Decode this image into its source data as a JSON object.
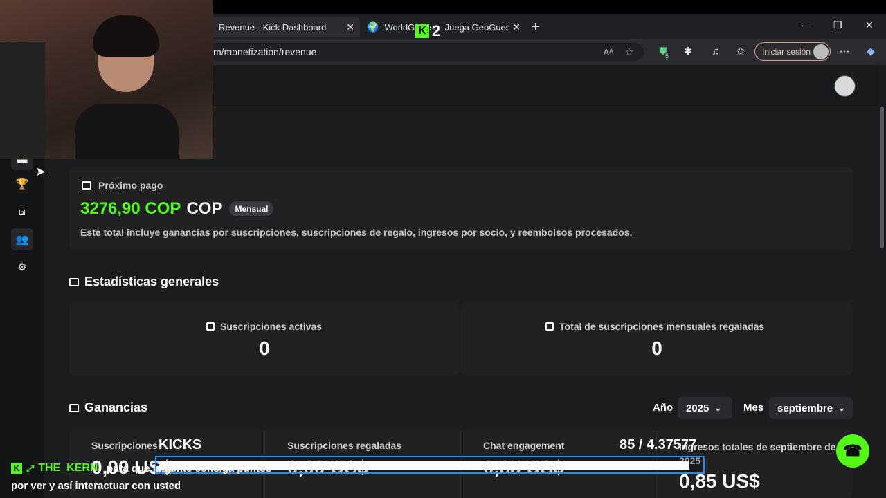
{
  "browser": {
    "tabs": [
      {
        "label": "Revenue - Kick Dashboard",
        "active": true
      },
      {
        "label": "WorldGuessr - Juega GeoGuessr g",
        "active": false
      }
    ],
    "new_tab_glyph": "+",
    "url": "m/monetization/revenue",
    "signin_label": "Iniciar sesión",
    "extension_badge": "5"
  },
  "sidebar": {
    "items": [
      {
        "icon": "dash-icon",
        "glyph": "▬"
      },
      {
        "icon": "trophy-icon",
        "glyph": "🏆"
      },
      {
        "icon": "stream-icon",
        "glyph": "⧈"
      },
      {
        "icon": "users-icon",
        "glyph": "👥"
      },
      {
        "icon": "gear-icon",
        "glyph": "⚙"
      }
    ]
  },
  "next_payment": {
    "label": "Próximo pago",
    "amount": "3276,90 COP",
    "currency": "COP",
    "badge": "Mensual",
    "description": "Este total incluye ganancias por suscripciones, suscripciones de regalo, ingresos por socio, y reembolsos procesados."
  },
  "stats": {
    "title": "Estadísticas generales",
    "items": [
      {
        "label": "Suscripciones activas",
        "value": "0"
      },
      {
        "label": "Total de suscripciones mensuales regaladas",
        "value": "0"
      }
    ]
  },
  "earnings": {
    "title": "Ganancias",
    "year_label": "Año",
    "year_value": "2025",
    "month_label": "Mes",
    "month_value": "septiembre",
    "columns": [
      {
        "label": "Suscripciones",
        "value": "0,00 US$"
      },
      {
        "label": "Suscripciones regaladas",
        "value": "0,00 US$"
      },
      {
        "label": "Chat engagement",
        "value": "0,85 US$"
      },
      {
        "label": "Ingresos totales de septiembre de 2025",
        "value": "0,85 US$"
      }
    ]
  },
  "overlay": {
    "kick_count_badge": "2",
    "kicks_label": "KICKS",
    "progress_text": "85   / 4.37577",
    "progress_fraction": 0.98
  },
  "chat": {
    "username": "THE_KERN",
    "message_line1": "para que la gente consiga puntos",
    "message_line2": "por ver y así interactuar con usted"
  },
  "colors": {
    "accent": "#53fc18",
    "page_bg": "#1b1c1d",
    "card_bg": "#202123"
  }
}
